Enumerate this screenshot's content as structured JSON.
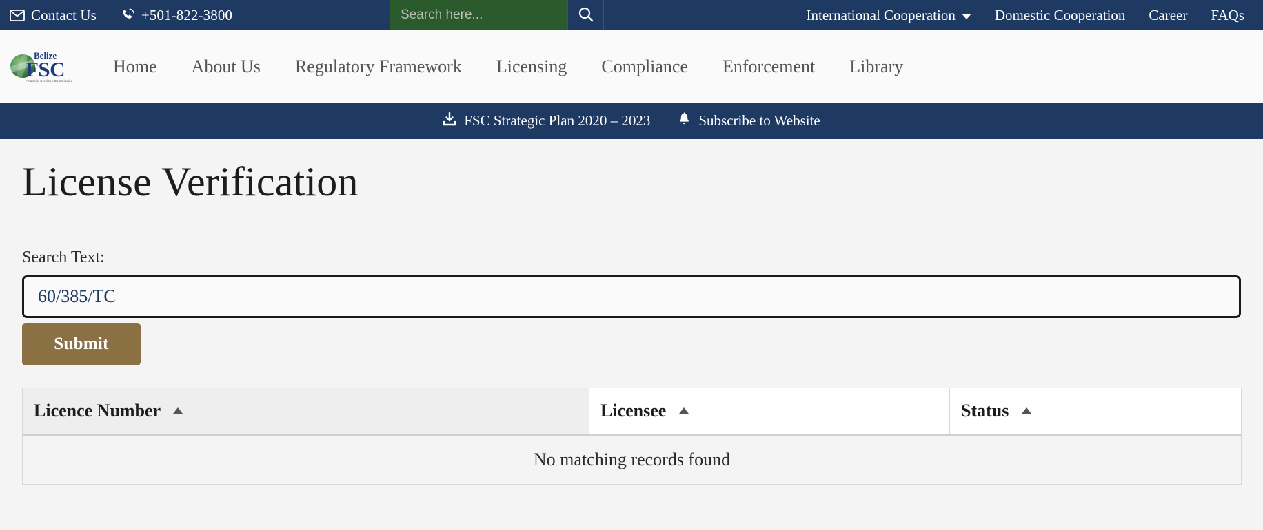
{
  "topbar": {
    "contact_label": "Contact Us",
    "contact_icon": "envelope-icon",
    "phone_label": "+501-822-3800",
    "phone_icon": "phone-icon",
    "search_placeholder": "Search here...",
    "search_value": "",
    "search_button_icon": "search-icon",
    "links": [
      {
        "label": "International Cooperation",
        "has_caret": true
      },
      {
        "label": "Domestic Cooperation",
        "has_caret": false
      },
      {
        "label": "Career",
        "has_caret": false
      },
      {
        "label": "FAQs",
        "has_caret": false
      }
    ],
    "background_color": "#1e3a63",
    "search_background_color": "#2b5b2c"
  },
  "logo": {
    "icon": "belize-fsc-globe-logo",
    "belize_text": "Belize",
    "fsc_text": "FSC",
    "tagline": "Financial Services Commission"
  },
  "mainnav": {
    "items": [
      {
        "label": "Home"
      },
      {
        "label": "About Us"
      },
      {
        "label": "Regulatory Framework"
      },
      {
        "label": "Licensing"
      },
      {
        "label": "Compliance"
      },
      {
        "label": "Enforcement"
      },
      {
        "label": "Library"
      }
    ]
  },
  "subbar": {
    "items": [
      {
        "label": "FSC Strategic Plan 2020 – 2023",
        "icon": "download-icon"
      },
      {
        "label": "Subscribe to Website",
        "icon": "bell-icon"
      }
    ]
  },
  "main": {
    "page_title": "License Verification",
    "search_label": "Search Text:",
    "search_value": "60/385/TC",
    "search_placeholder": "",
    "submit_label": "Submit",
    "submit_color": "#8b7043"
  },
  "table": {
    "columns": [
      {
        "label": "Licence Number",
        "sort": "ascending",
        "sorted_active": true
      },
      {
        "label": "Licensee",
        "sort": "ascending",
        "sorted_active": false
      },
      {
        "label": "Status",
        "sort": "ascending",
        "sorted_active": false
      }
    ],
    "rows": [],
    "empty_message": "No matching records found"
  }
}
